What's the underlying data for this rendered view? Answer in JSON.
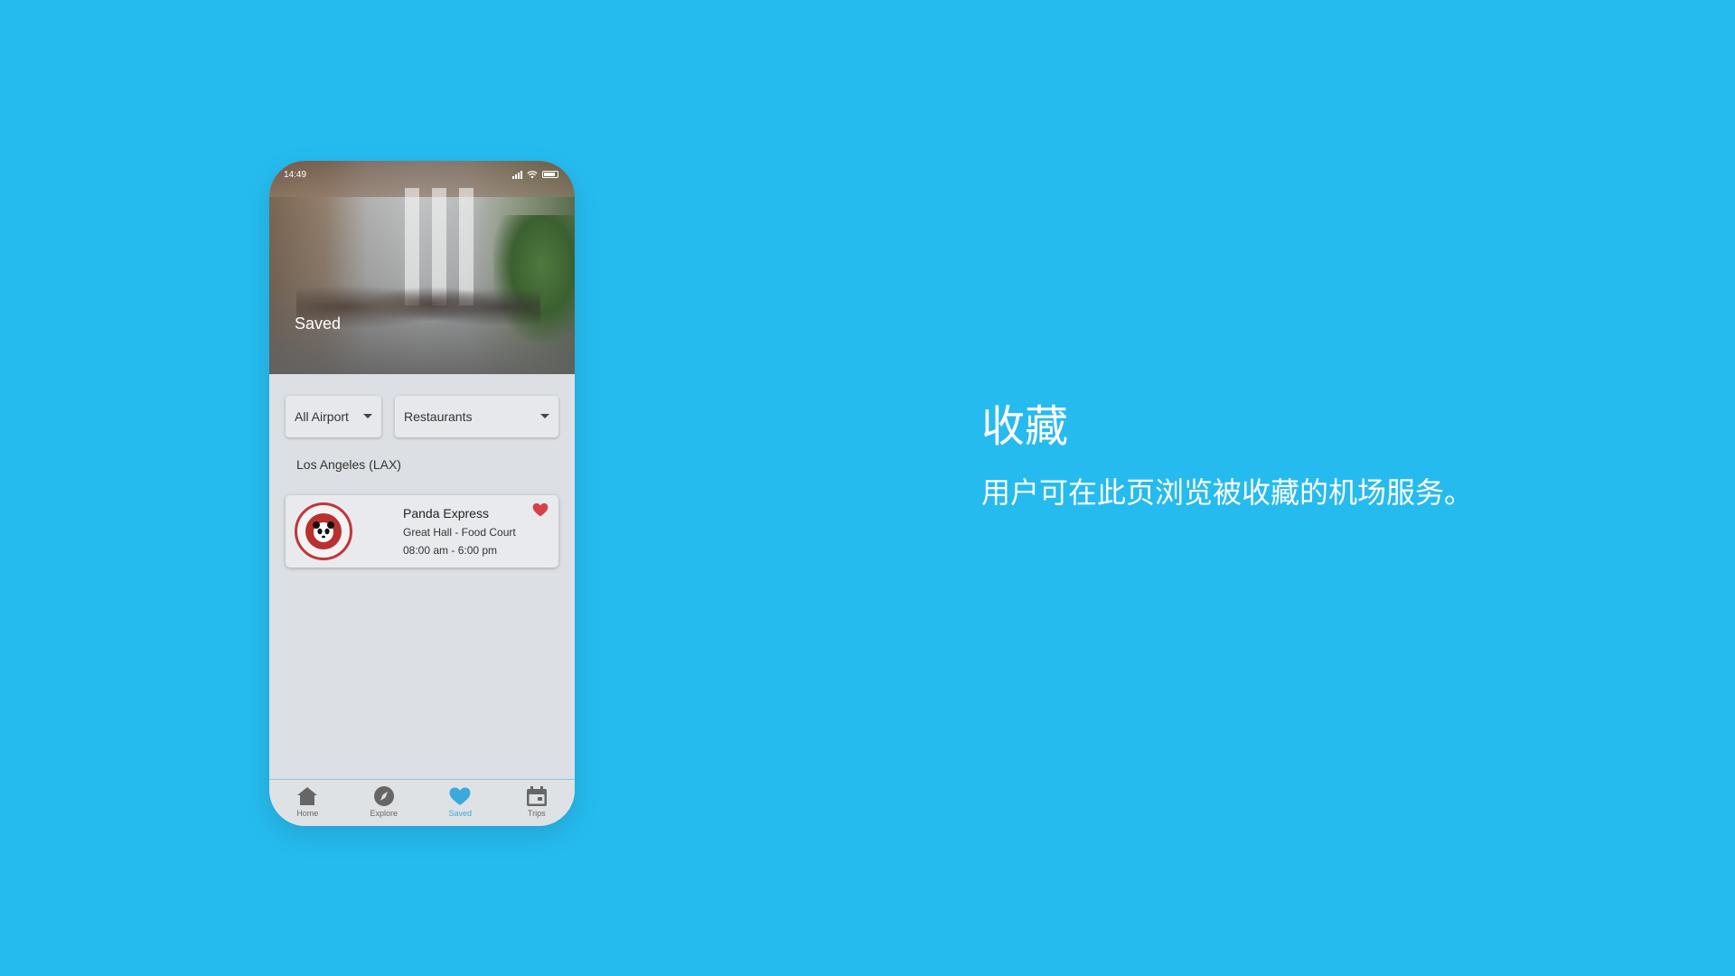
{
  "status_bar": {
    "time": "14:49"
  },
  "hero": {
    "title": "Saved"
  },
  "filters": {
    "airport": "All Airport",
    "category": "Restaurants"
  },
  "location": {
    "heading": "Los Angeles (LAX)"
  },
  "saved_items": [
    {
      "name": "Panda Express",
      "location": "Great Hall - Food Court",
      "hours": "08:00 am - 6:00 pm",
      "logo": "panda-express-logo",
      "favorited": true
    }
  ],
  "tabbar": {
    "items": [
      {
        "label": "Home",
        "icon": "home-icon"
      },
      {
        "label": "Explore",
        "icon": "compass-icon"
      },
      {
        "label": "Saved",
        "icon": "heart-icon",
        "active": true
      },
      {
        "label": "Trips",
        "icon": "calendar-icon"
      }
    ]
  },
  "caption": {
    "title": "收藏",
    "description": "用户可在此页浏览被收藏的机场服务。"
  },
  "colors": {
    "background": "#26BBEE",
    "accent": "#3AA9DD",
    "favorite": "#D6404A"
  }
}
